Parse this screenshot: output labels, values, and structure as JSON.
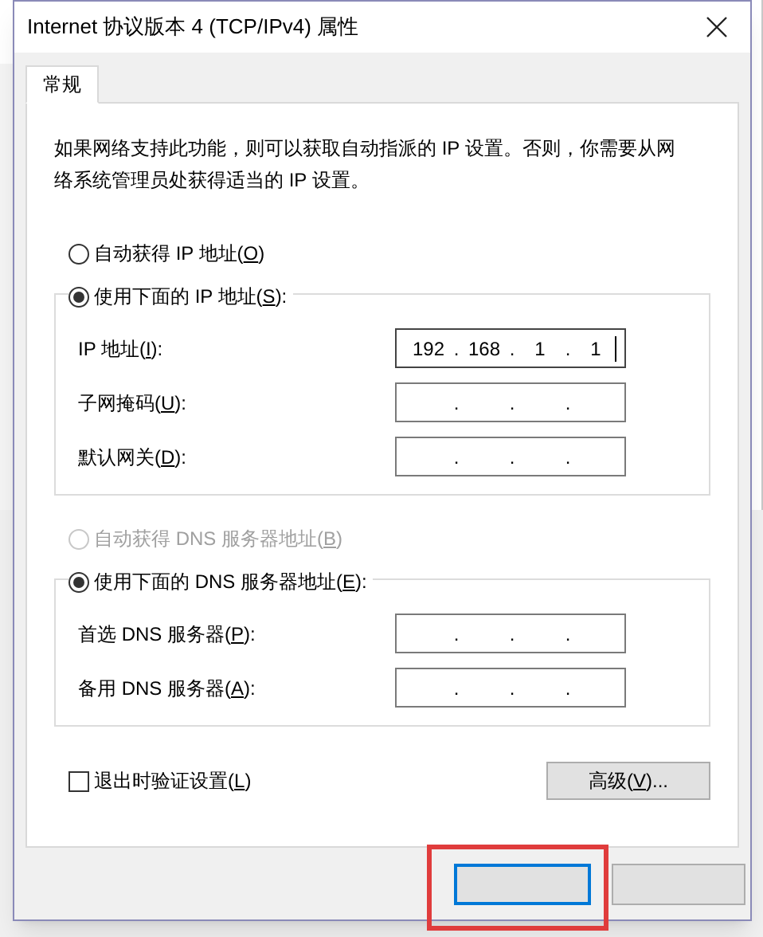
{
  "window": {
    "title": "Internet 协议版本 4 (TCP/IPv4) 属性"
  },
  "tabs": [
    {
      "label": "常规",
      "selected": true
    }
  ],
  "description": "如果网络支持此功能，则可以获取自动指派的 IP 设置。否则，你需要从网络系统管理员处获得适当的 IP 设置。",
  "ip_group": {
    "options": [
      {
        "before": "自动获得 IP 地址(",
        "key": "O",
        "after": ")",
        "selected": false,
        "disabled": false
      },
      {
        "before": "使用下面的 IP 地址(",
        "key": "S",
        "after": "):",
        "selected": true,
        "disabled": false
      }
    ],
    "fields": [
      {
        "before": "IP 地址(",
        "key": "I",
        "after": "):",
        "octets": [
          "192",
          "168",
          "1",
          "1"
        ],
        "separators": [
          ".",
          ".",
          "."
        ],
        "focused": true
      },
      {
        "before": "子网掩码(",
        "key": "U",
        "after": "):",
        "separators": [
          ".",
          ".",
          "."
        ],
        "focused": false
      },
      {
        "before": "默认网关(",
        "key": "D",
        "after": "):",
        "separators": [
          ".",
          ".",
          "."
        ],
        "focused": false
      }
    ]
  },
  "dns_group": {
    "options": [
      {
        "before": "自动获得 DNS 服务器地址(",
        "key": "B",
        "after": ")",
        "selected": false,
        "disabled": true
      },
      {
        "before": "使用下面的 DNS 服务器地址(",
        "key": "E",
        "after": "):",
        "selected": true,
        "disabled": false
      }
    ],
    "fields": [
      {
        "before": "首选 DNS 服务器(",
        "key": "P",
        "after": "):",
        "separators": [
          ".",
          ".",
          "."
        ],
        "focused": false
      },
      {
        "before": "备用 DNS 服务器(",
        "key": "A",
        "after": "):",
        "separators": [
          ".",
          ".",
          "."
        ],
        "focused": false
      }
    ]
  },
  "validate_checkbox": {
    "before": "退出时验证设置(",
    "key": "L",
    "after": ")",
    "checked": false
  },
  "advanced_button": {
    "before": "高级(",
    "key": "V",
    "after": ")..."
  },
  "footer_buttons": [
    {
      "kind": "ok",
      "default": true
    },
    {
      "kind": "cancel",
      "default": false
    }
  ],
  "annotation": {
    "kind": "highlight-box"
  }
}
